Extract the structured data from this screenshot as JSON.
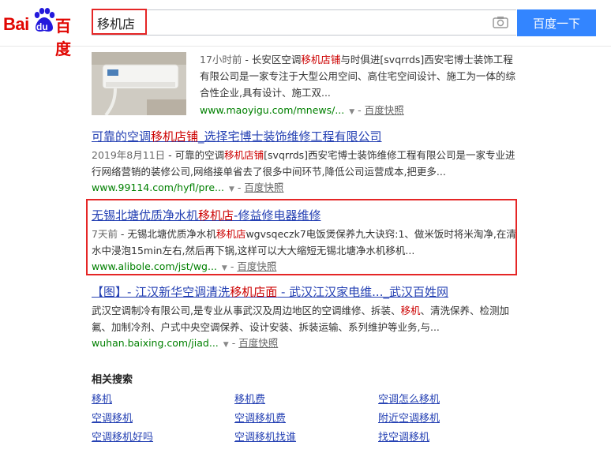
{
  "header": {
    "logo_bai": "Bai",
    "logo_du": "du",
    "logo_cn": "百度",
    "search_value": "移机店",
    "search_button": "百度一下",
    "camera_icon": "camera-icon"
  },
  "results": [
    {
      "abstract": {
        "date": "17小时前",
        "sep": " - ",
        "pre": "长安区空调",
        "hl": "移机店铺",
        "post": "与时俱进[svqrrds]西安宅博士装饰工程有限公司是一家专注于大型公用空间、高住宅空间设计、施工为一体的综合性企业,具有设计、施工双..."
      },
      "url": "www.maoyigu.com/mnews/...",
      "cache": "百度快照"
    },
    {
      "title_pre": "可靠的空调",
      "title_hl": "移机店铺",
      "title_post": "_选择宅博士装饰维修工程有限公司",
      "abstract": {
        "date": "2019年8月11日",
        "sep": " - ",
        "pre": "可靠的空调",
        "hl": "移机店铺",
        "post": "[svqrrds]西安宅博士装饰维修工程有限公司是一家专业进行网络营销的装修公司,网络接单省去了很多中间环节,降低公司运营成本,把更多..."
      },
      "url": "www.99114.com/hyfl/pre...",
      "cache": "百度快照"
    },
    {
      "title_pre": "无锡北塘优质净水机",
      "title_hl": "移机店",
      "title_post": "-修益修电器维修",
      "abstract": {
        "date": "7天前",
        "sep": " - ",
        "pre": "无锡北塘优质净水机",
        "hl": "移机店",
        "post": "wgvsqeczk7电饭煲保养九大诀窍:1、做米饭时将米淘净,在清水中浸泡15min左右,然后再下锅,这样可以大大缩短无锡北塘净水机移机..."
      },
      "url": "www.alibole.com/jst/wg...",
      "cache": "百度快照"
    },
    {
      "title_pre": "【图】- 江汉新华空调清洗",
      "title_hl": "移机店面",
      "title_post": " - 武汉江汉家电维..._武汉百姓网",
      "abstract": {
        "pre": "武汉空调制冷有限公司,是专业从事武汉及周边地区的空调维修、拆装、",
        "hl": "移机",
        "post": "、清洗保养、检测加氟、加制冷剂、户式中央空调保养、设计安装、拆装运输、系列维护等业务,与..."
      },
      "url": "wuhan.baixing.com/jiad...",
      "cache": "百度快照"
    }
  ],
  "related": {
    "title": "相关搜索",
    "items": [
      "移机",
      "移机费",
      "空调怎么移机",
      "空调移机",
      "空调移机费",
      "附近空调移机",
      "空调移机好吗",
      "空调移机找谁",
      "找空调移机"
    ]
  },
  "colors": {
    "brand_red": "#e10602",
    "brand_blue": "#2319dc",
    "button_blue": "#3385ff",
    "link": "#2440b3",
    "highlight": "#cc0000",
    "url_green": "#008000",
    "annotation_red": "#e52626"
  }
}
